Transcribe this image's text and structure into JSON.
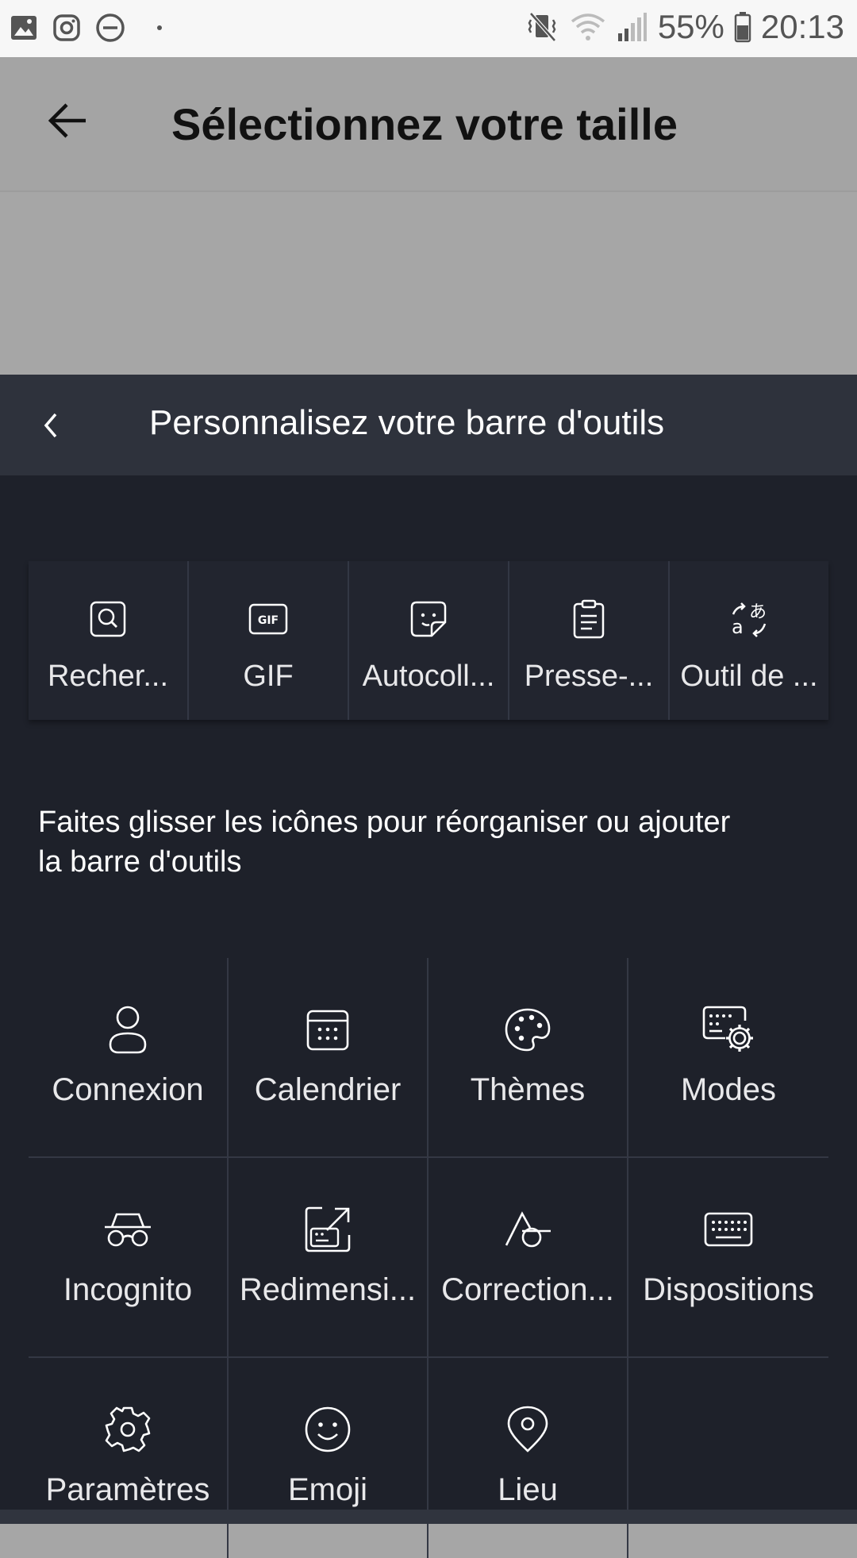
{
  "status_bar": {
    "left_icons": [
      "gallery-icon",
      "instagram-icon",
      "do-not-disturb-icon"
    ],
    "right_icons": [
      "vibrate-mute-icon",
      "wifi-icon",
      "signal-icon",
      "battery-icon"
    ],
    "battery_percent": "55%",
    "time": "20:13"
  },
  "app_header": {
    "title": "Sélectionnez votre taille"
  },
  "panel": {
    "title": "Personnalisez votre barre d'outils",
    "toolbar": [
      {
        "label": "Recher...",
        "icon": "search-icon"
      },
      {
        "label": "GIF",
        "icon": "gif-icon"
      },
      {
        "label": "Autocoll...",
        "icon": "sticker-icon"
      },
      {
        "label": "Presse-...",
        "icon": "clipboard-icon"
      },
      {
        "label": "Outil de ...",
        "icon": "translate-icon"
      }
    ],
    "instructions": "Faites glisser les icônes pour réorganiser ou ajouter la barre d'outils",
    "grid": [
      {
        "label": "Connexion",
        "icon": "user-icon"
      },
      {
        "label": "Calendrier",
        "icon": "calendar-icon"
      },
      {
        "label": "Thèmes",
        "icon": "palette-icon"
      },
      {
        "label": "Modes",
        "icon": "keyboard-settings-icon"
      },
      {
        "label": "Incognito",
        "icon": "incognito-icon"
      },
      {
        "label": "Redimensi...",
        "icon": "resize-icon"
      },
      {
        "label": "Correction...",
        "icon": "autocorrect-icon"
      },
      {
        "label": "Dispositions",
        "icon": "keyboard-icon"
      },
      {
        "label": "Paramètres",
        "icon": "gear-icon"
      },
      {
        "label": "Emoji",
        "icon": "emoji-icon"
      },
      {
        "label": "Lieu",
        "icon": "location-icon"
      }
    ]
  },
  "colors": {
    "panel_background": "#1e212a",
    "panel_header": "#2e323c",
    "dimmed_overlay": "#a6a6a6",
    "icon_stroke": "#ffffff"
  }
}
